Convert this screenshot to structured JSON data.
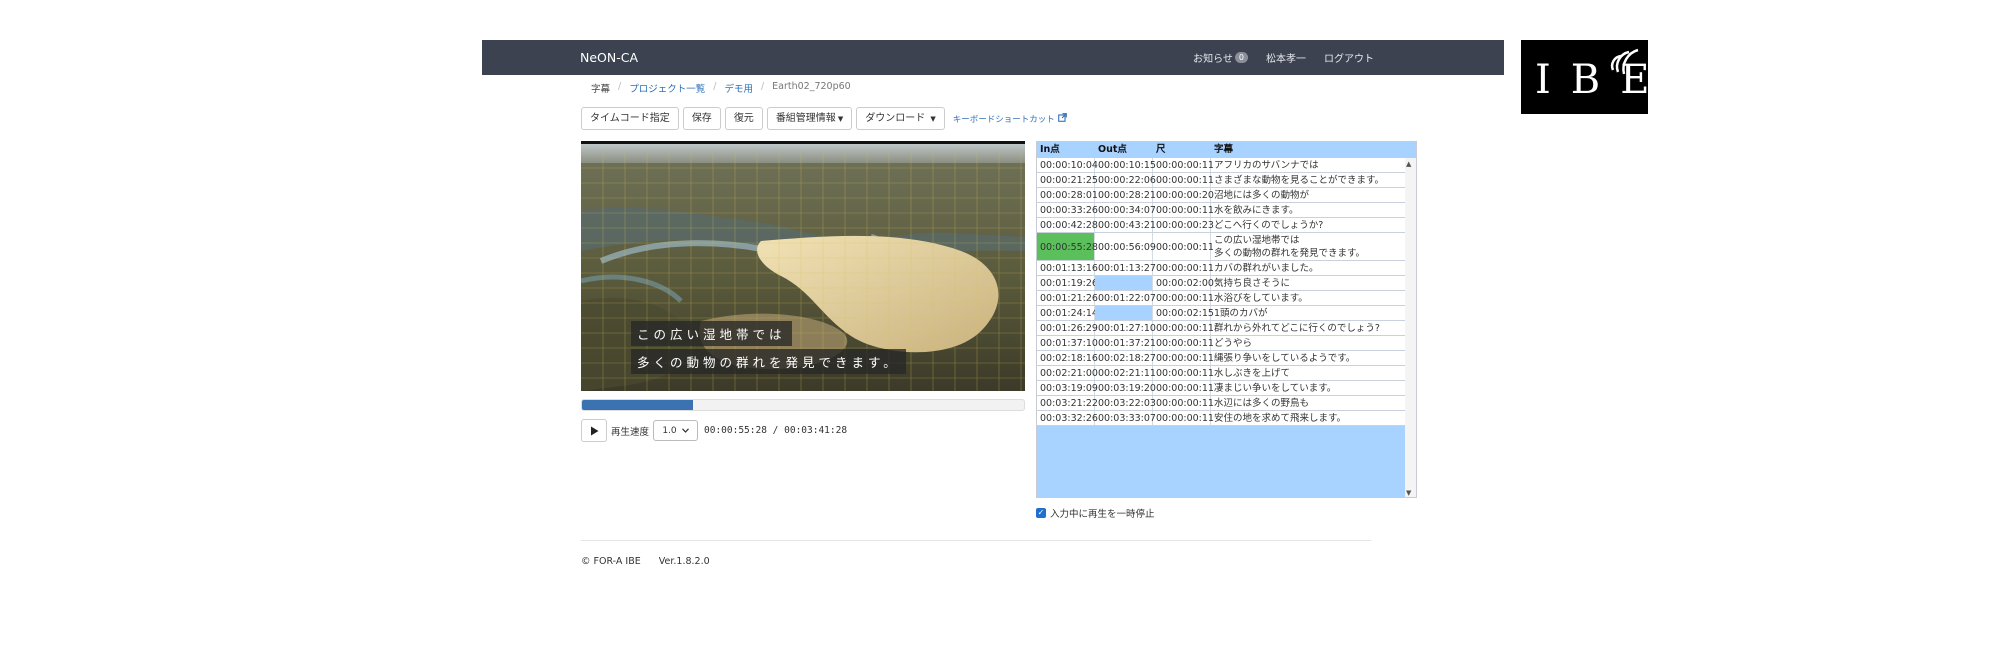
{
  "navbar": {
    "brand": "NeON-CA",
    "notice_label": "お知らせ",
    "notice_count": "0",
    "user_name": "松本孝一",
    "logout_label": "ログアウト",
    "bg_color": "#3c4250"
  },
  "logo": {
    "text": "IBE"
  },
  "breadcrumb": {
    "items": [
      "字幕",
      "プロジェクト一覧",
      "デモ用",
      "Earth02_720p60"
    ]
  },
  "toolbar": {
    "timecode_label": "タイムコード指定",
    "save_label": "保存",
    "restore_label": "復元",
    "program_info_label": "番組管理情報",
    "download_label": "ダウンロード",
    "shortcut_label": "キーボードショートカット"
  },
  "video": {
    "subtitle_line1": "この広い湿地帯では",
    "subtitle_line2": "多くの動物の群れを発見できます。"
  },
  "player": {
    "progress_fraction": 0.25,
    "speed_label": "再生速度",
    "speed_value": "1.0",
    "current_time": "00:00:55:28",
    "separator": "/",
    "total_time": "00:03:41:28",
    "accent_color": "#3a72b2"
  },
  "table": {
    "headers": [
      "In点",
      "Out点",
      "尺",
      "字幕"
    ],
    "rows": [
      {
        "in": "00:00:10:04",
        "out": "00:00:10:15",
        "dur": "00:00:00:11",
        "text": [
          "アフリカのサバンナでは"
        ]
      },
      {
        "in": "00:00:21:25",
        "out": "00:00:22:06",
        "dur": "00:00:00:11",
        "text": [
          "さまざまな動物を見ることができます。"
        ]
      },
      {
        "in": "00:00:28:01",
        "out": "00:00:28:21",
        "dur": "00:00:00:20",
        "text": [
          "沼地には多くの動物が"
        ]
      },
      {
        "in": "00:00:33:26",
        "out": "00:00:34:07",
        "dur": "00:00:00:11",
        "text": [
          "水を飲みにきます。"
        ]
      },
      {
        "in": "00:00:42:28",
        "out": "00:00:43:21",
        "dur": "00:00:00:23",
        "text": [
          "どこへ行くのでしょうか?"
        ]
      },
      {
        "in": "00:00:55:28",
        "out": "00:00:56:09",
        "dur": "00:00:00:11",
        "text": [
          "この広い湿地帯では",
          "多くの動物の群れを発見できます。"
        ],
        "active": true
      },
      {
        "in": "00:01:13:16",
        "out": "00:01:13:27",
        "dur": "00:00:00:11",
        "text": [
          "カバの群れがいました。"
        ]
      },
      {
        "in": "00:01:19:26",
        "out": "",
        "dur": "00:00:02:00",
        "text": [
          "気持ち良さそうに"
        ]
      },
      {
        "in": "00:01:21:26",
        "out": "00:01:22:07",
        "dur": "00:00:00:11",
        "text": [
          "水浴びをしています。"
        ]
      },
      {
        "in": "00:01:24:14",
        "out": "",
        "dur": "00:00:02:15",
        "text": [
          "1頭のカバが"
        ]
      },
      {
        "in": "00:01:26:29",
        "out": "00:01:27:10",
        "dur": "00:00:00:11",
        "text": [
          "群れから外れてどこに行くのでしょう?"
        ]
      },
      {
        "in": "00:01:37:10",
        "out": "00:01:37:21",
        "dur": "00:00:00:11",
        "text": [
          "どうやら"
        ]
      },
      {
        "in": "00:02:18:16",
        "out": "00:02:18:27",
        "dur": "00:00:00:11",
        "text": [
          "縄張り争いをしているようです。"
        ]
      },
      {
        "in": "00:02:21:00",
        "out": "00:02:21:11",
        "dur": "00:00:00:11",
        "text": [
          "水しぶきを上げて"
        ]
      },
      {
        "in": "00:03:19:09",
        "out": "00:03:19:20",
        "dur": "00:00:00:11",
        "text": [
          "凄まじい争いをしています。"
        ]
      },
      {
        "in": "00:03:21:22",
        "out": "00:03:22:03",
        "dur": "00:00:00:11",
        "text": [
          "水辺には多くの野鳥も"
        ]
      },
      {
        "in": "00:03:32:26",
        "out": "00:03:33:07",
        "dur": "00:00:00:11",
        "text": [
          "安住の地を求めて飛来します。"
        ]
      }
    ],
    "bg_color": "#a8d2ff",
    "active_color": "#5bbf5b"
  },
  "options": {
    "pause_on_input_label": "入力中に再生を一時停止",
    "pause_on_input_checked": true
  },
  "footer": {
    "copyright": "© FOR-A IBE",
    "version": "Ver.1.8.2.0"
  }
}
